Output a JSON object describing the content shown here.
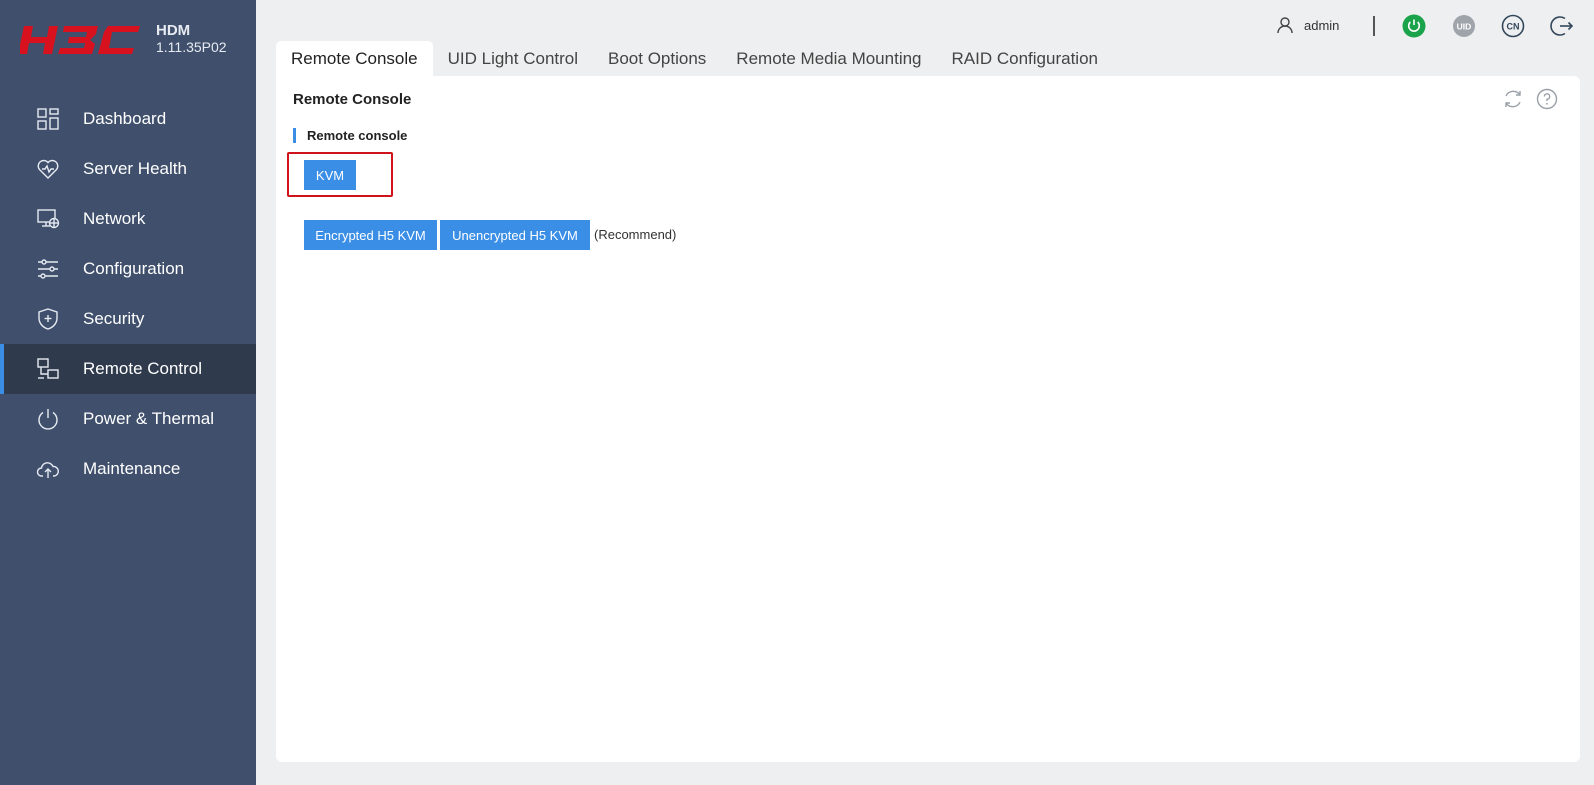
{
  "brand": {
    "logo_text": "H3C",
    "product_name": "HDM",
    "version": "1.11.35P02",
    "logo_color": "#d7111d"
  },
  "sidebar": {
    "items": [
      {
        "label": "Dashboard",
        "icon": "dashboard-icon"
      },
      {
        "label": "Server Health",
        "icon": "heart-icon"
      },
      {
        "label": "Network",
        "icon": "network-icon"
      },
      {
        "label": "Configuration",
        "icon": "sliders-icon"
      },
      {
        "label": "Security",
        "icon": "shield-icon"
      },
      {
        "label": "Remote Control",
        "icon": "remote-control-icon",
        "active": true
      },
      {
        "label": "Power & Thermal",
        "icon": "power-icon"
      },
      {
        "label": "Maintenance",
        "icon": "cloud-upload-icon"
      }
    ]
  },
  "header": {
    "username": "admin",
    "power_status_color": "#1aa34a",
    "uid_label": "UID",
    "language_label": "CN"
  },
  "tabs": [
    {
      "label": "Remote Console",
      "active": true
    },
    {
      "label": "UID Light Control"
    },
    {
      "label": "Boot Options"
    },
    {
      "label": "Remote Media Mounting"
    },
    {
      "label": "RAID Configuration"
    }
  ],
  "panel": {
    "title": "Remote Console",
    "section_title": "Remote console",
    "kvm_button": "KVM",
    "encrypted_button": "Encrypted H5 KVM",
    "unencrypted_button": "Unencrypted H5 KVM",
    "recommend_text": "(Recommend)"
  },
  "colors": {
    "accent": "#3a8ee6",
    "sidebar_bg": "#3f4f6c",
    "highlight_border": "#d0121b"
  }
}
